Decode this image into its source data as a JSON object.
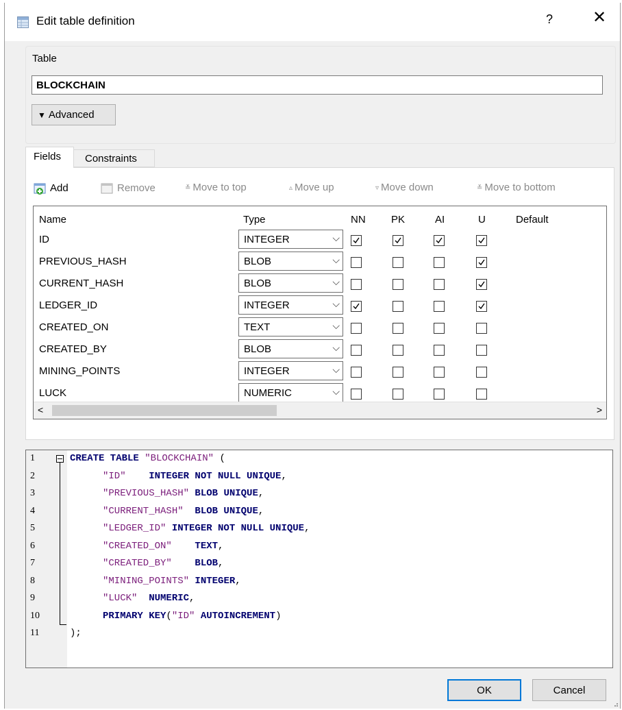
{
  "window": {
    "title": "Edit table definition",
    "help_label": "?",
    "close_label": "✕"
  },
  "table_group": {
    "label": "Table",
    "name_value": "BLOCKCHAIN",
    "advanced_label": "Advanced"
  },
  "tabs": [
    {
      "label": "Fields",
      "active": true
    },
    {
      "label": "Constraints",
      "active": false
    }
  ],
  "toolbar": {
    "add": "Add",
    "remove": "Remove",
    "move_top": "Move to top",
    "move_up": "Move up",
    "move_down": "Move down",
    "move_bottom": "Move to bottom"
  },
  "grid": {
    "headers": {
      "name": "Name",
      "type": "Type",
      "nn": "NN",
      "pk": "PK",
      "ai": "AI",
      "u": "U",
      "default": "Default"
    },
    "rows": [
      {
        "name": "ID",
        "type": "INTEGER",
        "nn": true,
        "pk": true,
        "ai": true,
        "u": true
      },
      {
        "name": "PREVIOUS_HASH",
        "type": "BLOB",
        "nn": false,
        "pk": false,
        "ai": false,
        "u": true
      },
      {
        "name": "CURRENT_HASH",
        "type": "BLOB",
        "nn": false,
        "pk": false,
        "ai": false,
        "u": true
      },
      {
        "name": "LEDGER_ID",
        "type": "INTEGER",
        "nn": true,
        "pk": false,
        "ai": false,
        "u": true
      },
      {
        "name": "CREATED_ON",
        "type": "TEXT",
        "nn": false,
        "pk": false,
        "ai": false,
        "u": false
      },
      {
        "name": "CREATED_BY",
        "type": "BLOB",
        "nn": false,
        "pk": false,
        "ai": false,
        "u": false
      },
      {
        "name": "MINING_POINTS",
        "type": "INTEGER",
        "nn": false,
        "pk": false,
        "ai": false,
        "u": false
      },
      {
        "name": "LUCK",
        "type": "NUMERIC",
        "nn": false,
        "pk": false,
        "ai": false,
        "u": false
      }
    ],
    "scroll_left": "<",
    "scroll_right": ">"
  },
  "sql": {
    "lines": [
      {
        "n": "1",
        "parts": [
          {
            "t": "kw",
            "s": "CREATE TABLE "
          },
          {
            "t": "str",
            "s": "\"BLOCKCHAIN\""
          },
          {
            "t": "plain",
            "s": " ("
          }
        ]
      },
      {
        "n": "2",
        "parts": [
          {
            "t": "str",
            "s": "\"ID\""
          },
          {
            "t": "kw",
            "s": "    INTEGER NOT NULL UNIQUE"
          },
          {
            "t": "plain",
            "s": ","
          }
        ]
      },
      {
        "n": "3",
        "parts": [
          {
            "t": "str",
            "s": "\"PREVIOUS_HASH\""
          },
          {
            "t": "kw",
            "s": " BLOB UNIQUE"
          },
          {
            "t": "plain",
            "s": ","
          }
        ]
      },
      {
        "n": "4",
        "parts": [
          {
            "t": "str",
            "s": "\"CURRENT_HASH\""
          },
          {
            "t": "kw",
            "s": "  BLOB UNIQUE"
          },
          {
            "t": "plain",
            "s": ","
          }
        ]
      },
      {
        "n": "5",
        "parts": [
          {
            "t": "str",
            "s": "\"LEDGER_ID\""
          },
          {
            "t": "kw",
            "s": " INTEGER NOT NULL UNIQUE"
          },
          {
            "t": "plain",
            "s": ","
          }
        ]
      },
      {
        "n": "6",
        "parts": [
          {
            "t": "str",
            "s": "\"CREATED_ON\""
          },
          {
            "t": "kw",
            "s": "    TEXT"
          },
          {
            "t": "plain",
            "s": ","
          }
        ]
      },
      {
        "n": "7",
        "parts": [
          {
            "t": "str",
            "s": "\"CREATED_BY\""
          },
          {
            "t": "kw",
            "s": "    BLOB"
          },
          {
            "t": "plain",
            "s": ","
          }
        ]
      },
      {
        "n": "8",
        "parts": [
          {
            "t": "str",
            "s": "\"MINING_POINTS\""
          },
          {
            "t": "kw",
            "s": " INTEGER"
          },
          {
            "t": "plain",
            "s": ","
          }
        ]
      },
      {
        "n": "9",
        "parts": [
          {
            "t": "str",
            "s": "\"LUCK\""
          },
          {
            "t": "kw",
            "s": "  NUMERIC"
          },
          {
            "t": "plain",
            "s": ","
          }
        ]
      },
      {
        "n": "10",
        "parts": [
          {
            "t": "kw",
            "s": "PRIMARY KEY"
          },
          {
            "t": "plain",
            "s": "("
          },
          {
            "t": "str",
            "s": "\"ID\""
          },
          {
            "t": "kw",
            "s": " AUTOINCREMENT"
          },
          {
            "t": "plain",
            "s": ")"
          }
        ]
      },
      {
        "n": "11",
        "parts": [
          {
            "t": "plain",
            "s": ");"
          }
        ]
      }
    ]
  },
  "buttons": {
    "ok": "OK",
    "cancel": "Cancel"
  }
}
